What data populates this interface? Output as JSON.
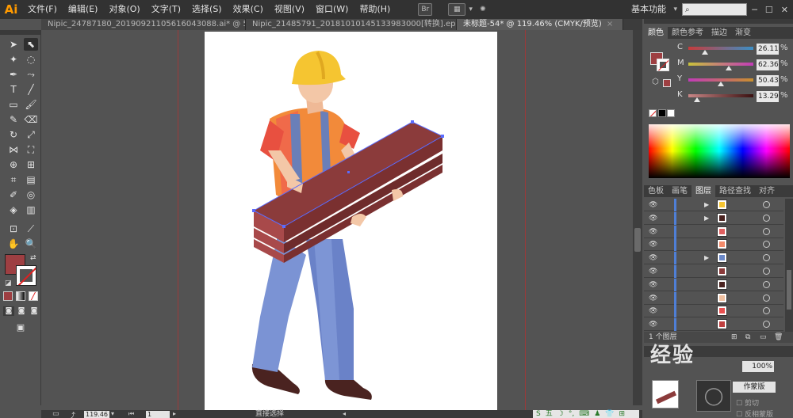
{
  "app": {
    "logo": "Ai"
  },
  "menu": [
    "文件(F)",
    "编辑(E)",
    "对象(O)",
    "文字(T)",
    "选择(S)",
    "效果(C)",
    "视图(V)",
    "窗口(W)",
    "帮助(H)"
  ],
  "menubar": {
    "br_label": "Br",
    "workspace": "基本功能",
    "workspace_caret": "▾",
    "search_icon": "search-icon"
  },
  "tabs": [
    {
      "label": "Nipic_24787180_20190921105616043088.ai* @ 50...",
      "active": false
    },
    {
      "label": "Nipic_21485791_20181010145133983000[转换].eps*",
      "active": false
    },
    {
      "label": "未标题-54* @ 119.46% (CMYK/预览)",
      "active": true
    }
  ],
  "tab_close": "×",
  "status": {
    "zoom": "119.46",
    "page": "1",
    "tool_name": "直接选择"
  },
  "ime": {
    "items": [
      "S",
      "五",
      "☽",
      "°,",
      "⌨",
      "♟",
      "👕",
      "⊞"
    ]
  },
  "panels": {
    "color_tabs": [
      "颜色",
      "颜色参考",
      "描边",
      "渐变"
    ],
    "cmyk": [
      {
        "channel": "C",
        "value": "26.11",
        "colors": [
          "#c63b3b",
          "#3b8fc6"
        ]
      },
      {
        "channel": "M",
        "value": "62.36",
        "colors": [
          "#c8c23b",
          "#c23bb8"
        ]
      },
      {
        "channel": "Y",
        "value": "50.43",
        "colors": [
          "#c23bb8",
          "#c8902d"
        ]
      },
      {
        "channel": "K",
        "value": "13.29",
        "colors": [
          "#c88686",
          "#3a1010"
        ]
      }
    ],
    "pct": "%",
    "swatch_tabs": [
      "色板",
      "画笔",
      "图层",
      "路径查找",
      "对齐"
    ],
    "layer_count": "1 个图层",
    "bottom": {
      "btn1": "作蒙版",
      "item1": "剪切",
      "item2": "反相蒙版"
    }
  },
  "layers": [
    {
      "thumb": "#f5c531",
      "arrow": true
    },
    {
      "thumb": "#4a2320",
      "arrow": true
    },
    {
      "thumb": "#e06060",
      "arrow": false
    },
    {
      "thumb": "#f28a6a",
      "arrow": false
    },
    {
      "thumb": "#6a88c8",
      "arrow": true
    },
    {
      "thumb": "#8b3b3b",
      "arrow": false
    },
    {
      "thumb": "#4a2320",
      "arrow": false
    },
    {
      "thumb": "#f0c0a0",
      "arrow": false
    },
    {
      "thumb": "#e85050",
      "arrow": false
    },
    {
      "thumb": "#c04040",
      "arrow": false
    }
  ],
  "colors": {
    "fill": "#9e3f42",
    "accent": "#4f7fd6",
    "guide": "#9a3a3a"
  },
  "watermark": "经验"
}
